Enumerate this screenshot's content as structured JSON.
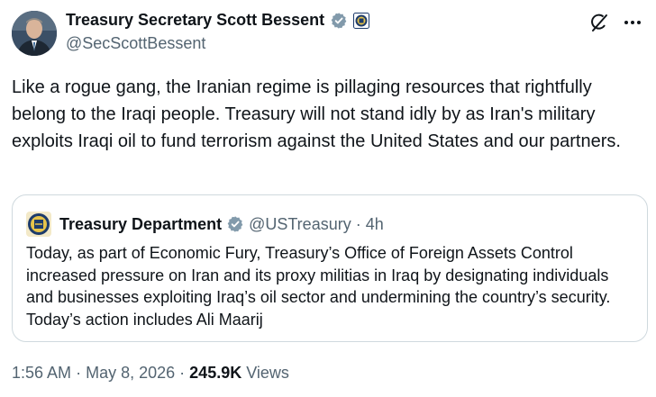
{
  "author": {
    "display_name": "Treasury Secretary Scott Bessent",
    "handle": "@SecScottBessent",
    "verified_icon": "verified-badge-icon",
    "affiliate_icon": "treasury-seal-icon"
  },
  "header_actions": {
    "grok_icon": "grok-icon",
    "more_icon": "more-options-icon"
  },
  "tweet": {
    "text": "Like a rogue gang, the Iranian regime is pillaging resources that rightfully belong to the Iraqi people. Treasury will not stand idly by as Iran's military exploits Iraqi oil to fund terrorism against the United States and our partners."
  },
  "quote": {
    "display_name": "Treasury Department",
    "handle": "@USTreasury",
    "separator": "·",
    "time": "4h",
    "text": "Today, as part of Economic Fury, Treasury’s Office of Foreign Assets Control increased pressure on Iran and its proxy militias in Iraq by designating individuals and businesses exploiting Iraq’s oil sector and undermining the country’s security. Today’s action includes Ali Maarij"
  },
  "footer": {
    "time": "1:56 AM",
    "sep1": "·",
    "date": "May 8, 2026",
    "sep2": "·",
    "views_count": "245.9K",
    "views_label": "Views"
  },
  "colors": {
    "text_primary": "#0f1419",
    "text_secondary": "#536471",
    "verified_gray": "#829aab",
    "border": "#cfd9de"
  }
}
